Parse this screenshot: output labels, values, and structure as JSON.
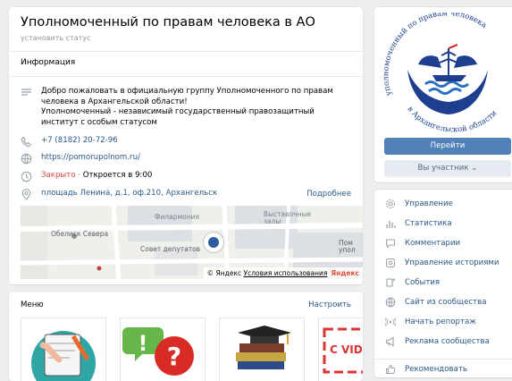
{
  "header": {
    "title": "Уполномоченный по правам человека в АО",
    "status_link": "установить статус"
  },
  "info": {
    "section_title": "Информация",
    "description": [
      "Добро пожаловать в официальную группу Уполномоченного по правам",
      "человека в Архангельской области!",
      "Уполномоченный - независимый государственный правозащитный",
      "институт с особым статусом"
    ],
    "phone": "+7 (8182) 20-72-96",
    "website": "https://pomorupolnom.ru/",
    "hours_status": "Закрыто",
    "hours_separator": " · ",
    "hours_next": "Откроется в 9:00",
    "address": "площадь Ленина, д.1, оф.210, Архангельск",
    "more_link": "Подробнее"
  },
  "map": {
    "labels": [
      "Филармония",
      "Выставочные залы",
      "Обелиск Севера",
      "Совет депутатов",
      "Пом упол"
    ],
    "copyright": "© Яндекс",
    "terms": "Условия использования",
    "brand": "Яндекс"
  },
  "menu": {
    "title": "Меню",
    "configure": "Настроить",
    "tiles": [
      "icon-notepad",
      "icon-question",
      "icon-graduation",
      "covid-banner"
    ],
    "covid_text": "C VID"
  },
  "avatar": {
    "logo_text_top": "уполномоченный по правам человека",
    "logo_text_bottom": "в Архангельской области"
  },
  "actions": {
    "go_button": "Перейти",
    "member_button": "Вы участник",
    "member_chevron": "⌄"
  },
  "sidebar_menu": [
    {
      "label": "Управление",
      "icon": "gear-icon"
    },
    {
      "label": "Статистика",
      "icon": "stats-icon"
    },
    {
      "label": "Комментарии",
      "icon": "comment-icon"
    },
    {
      "label": "Управление историями",
      "icon": "stories-icon"
    },
    {
      "label": "События",
      "icon": "events-icon"
    },
    {
      "label": "Сайт из сообщества",
      "icon": "globe-icon"
    },
    {
      "label": "Начать репортаж",
      "icon": "broadcast-icon"
    },
    {
      "label": "Реклама сообщества",
      "icon": "megaphone-icon"
    },
    {
      "label": "Рекомендовать",
      "icon": "thumbsup-icon"
    }
  ],
  "colors": {
    "accent": "#5181b8",
    "link": "#2a5885",
    "background": "#edeef0",
    "closed_red": "#e64646",
    "logo_blue": "#1e3f8f"
  }
}
